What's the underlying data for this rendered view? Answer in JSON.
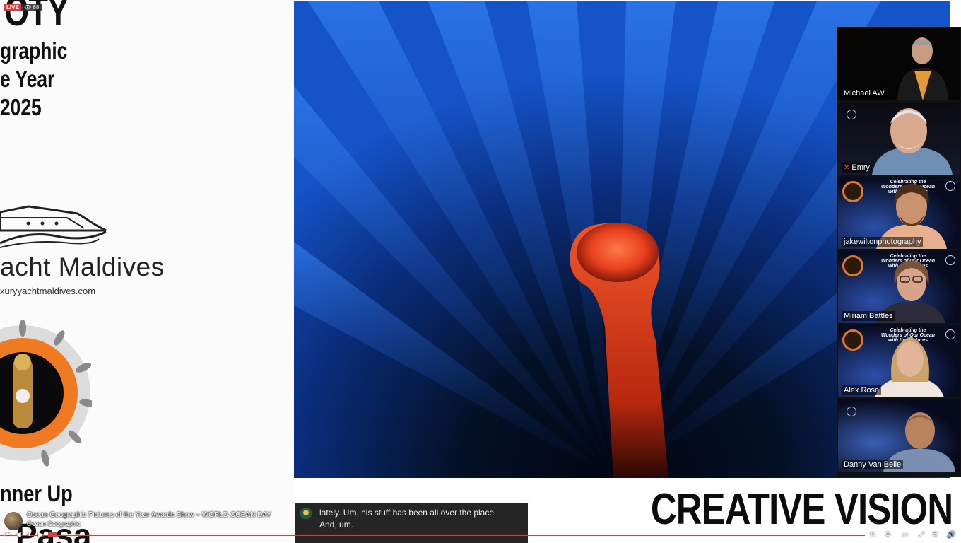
{
  "stream": {
    "live_label": "LIVE",
    "viewer_count": "68",
    "title": "Ocean Geographic Pictures of the Year Awards Show – WORLD OCEAN DAY",
    "channel": "Ocean Geographic",
    "progress": 0.9
  },
  "slide": {
    "brand_lines": [
      "OTY",
      "graphic",
      "e Year",
      " 2025"
    ],
    "yacht_name": "acht Maldives",
    "yacht_url": "xuryyachtmaldives.com",
    "award_title": "nner Up",
    "award_sub": "Pasa",
    "category": "CREATIVE VISION"
  },
  "participants": [
    {
      "name": "Michael AW",
      "muted": false,
      "active": false
    },
    {
      "name": "Emry",
      "muted": true,
      "active": false
    },
    {
      "name": "jakewiltonphotography",
      "muted": false,
      "active": false
    },
    {
      "name": "Miriam Battles",
      "muted": false,
      "active": false
    },
    {
      "name": "Alex Rose",
      "muted": false,
      "active": true
    },
    {
      "name": "Danny Van Belle",
      "muted": false,
      "active": false
    }
  ],
  "banner": {
    "line1": "Celebrating the",
    "line2": "Wonders of Our Ocean",
    "line3": "with the Pictures"
  },
  "captions": {
    "line1": "lately. Um, his stuff has been all over the place",
    "line2": "And, um."
  },
  "controls": {
    "prev_icon": "skip-previous-icon",
    "play_icon": "pause-icon",
    "next_icon": "skip-next-icon",
    "settings_icon": "gear-icon",
    "fullscreen_icon": "fullscreen-icon",
    "volume_icon": "volume-icon"
  },
  "colors": {
    "live": "#e33b3b",
    "active_speaker": "#43c16a",
    "photo_blue": "#1553c8",
    "anemone": "#e8401e"
  }
}
